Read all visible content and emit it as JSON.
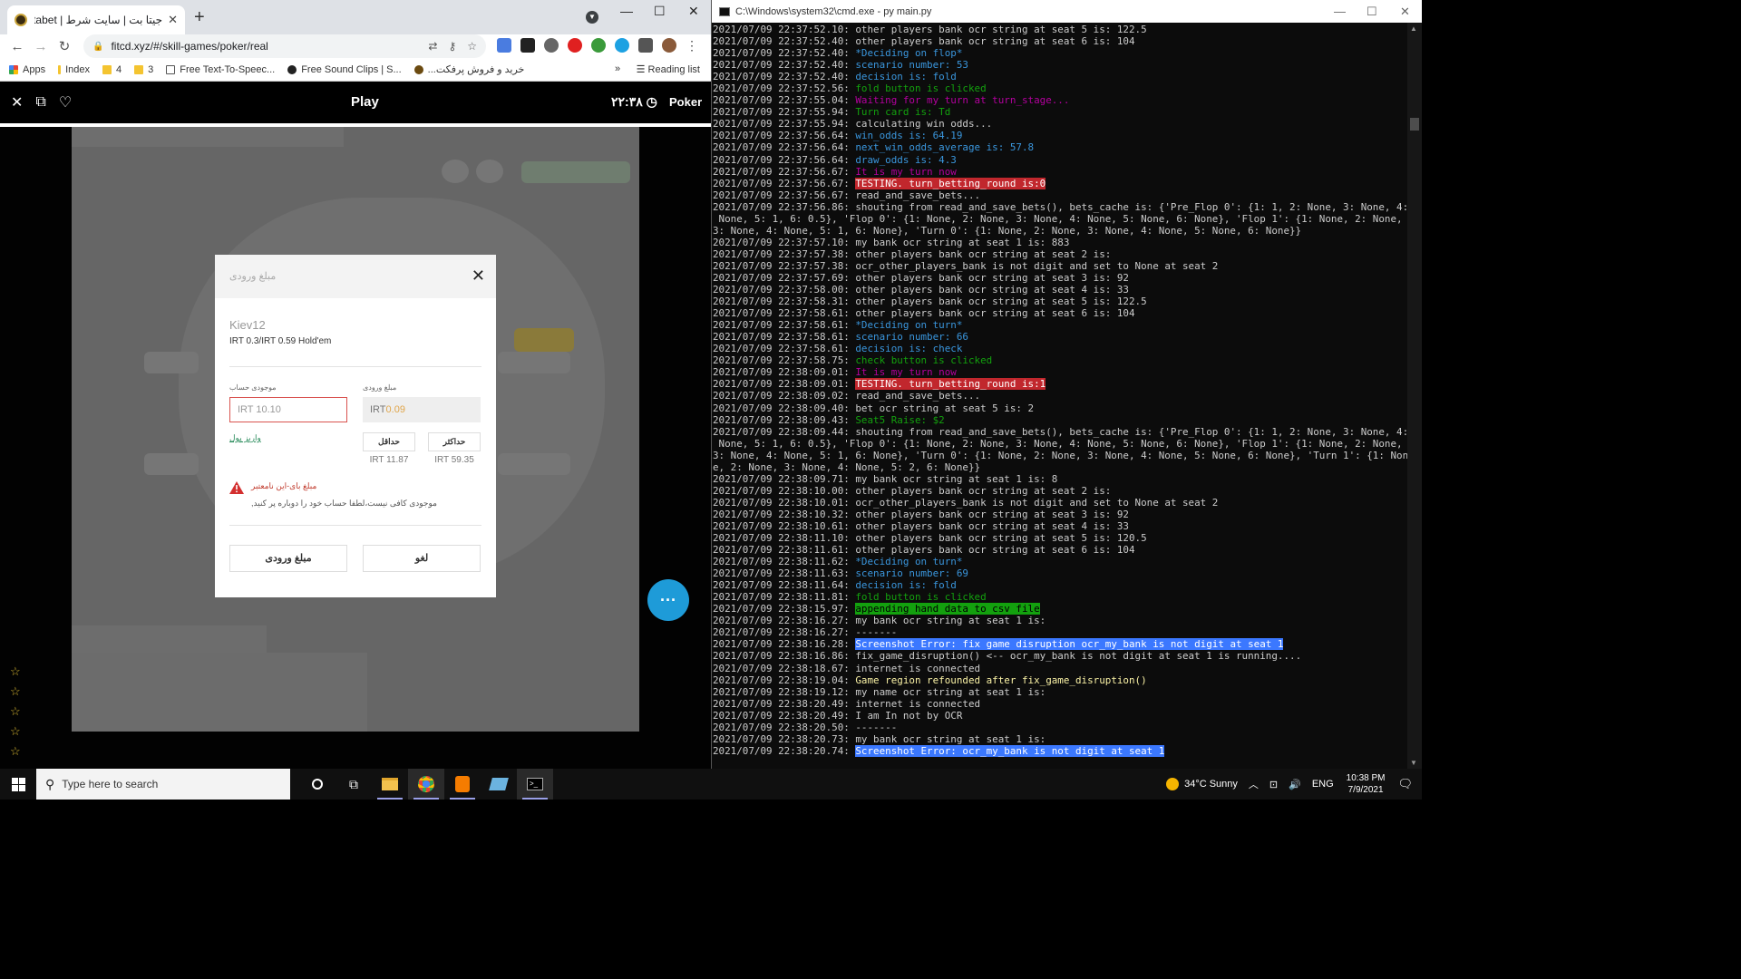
{
  "browser": {
    "tab_title": "جیتا بت | سایت شرط | cheetabet",
    "url": "fitcd.xyz/#/skill-games/poker/real",
    "bookmarks": [
      "Apps",
      "Index",
      "4",
      "3",
      "Free Text-To-Speec...",
      "Free Sound Clips | S...",
      "...خرید و فروش پرفکت"
    ],
    "reading_list": "Reading list"
  },
  "page": {
    "title": "Play",
    "clock": "۲۲:۳۸",
    "brand": "Poker"
  },
  "modal": {
    "title": "مبلغ ورودی",
    "room": "Kiev12",
    "stakes": "IRT 0.3/IRT 0.59 Hold'em",
    "balance_label": "موجودی حساب",
    "entry_label": "مبلغ ورودی",
    "balance_value": "IRT 10.10",
    "entry_prefix": "IRT",
    "entry_value": "0.09",
    "deposit_link": "واریز پول",
    "min_label": "حداقل",
    "max_label": "حداکثر",
    "min_value": "IRT 11.87",
    "max_value": "IRT 59.35",
    "warning_title": "مبلغ بای-این نامعتبر",
    "warning_text": ",موجودی کافی نیست،لطفا حساب خود را دوباره پر کنید",
    "confirm_label": "مبلغ ورودی",
    "cancel_label": "لغو"
  },
  "console": {
    "title": "C:\\Windows\\system32\\cmd.exe - py  main.py",
    "lines": [
      {
        "ts": "2021/07/09 22:37:52.10:",
        "msg": "other players bank ocr string at seat 5 is: 122.5",
        "style": "normal"
      },
      {
        "ts": "2021/07/09 22:37:52.40:",
        "msg": "other players bank ocr string at seat 6 is: 104",
        "style": "normal"
      },
      {
        "ts": "2021/07/09 22:37:52.40:",
        "msg": "*Deciding on flop*",
        "style": "cyan"
      },
      {
        "ts": "2021/07/09 22:37:52.40:",
        "msg": "scenario number: 53",
        "style": "cyan"
      },
      {
        "ts": "2021/07/09 22:37:52.40:",
        "msg": "decision is: fold",
        "style": "cyan"
      },
      {
        "ts": "2021/07/09 22:37:52.56:",
        "msg": "fold button is clicked",
        "style": "green"
      },
      {
        "ts": "2021/07/09 22:37:55.04:",
        "msg": "Waiting for my turn at turn_stage...",
        "style": "magenta"
      },
      {
        "ts": "2021/07/09 22:37:55.94:",
        "msg": "Turn card is: Td",
        "style": "green"
      },
      {
        "ts": "2021/07/09 22:37:55.94:",
        "msg": "calculating win odds...",
        "style": "normal"
      },
      {
        "ts": "2021/07/09 22:37:56.64:",
        "msg": "win_odds is: 64.19",
        "style": "cyan"
      },
      {
        "ts": "2021/07/09 22:37:56.64:",
        "msg": "next_win_odds_average is: 57.8",
        "style": "cyan"
      },
      {
        "ts": "2021/07/09 22:37:56.64:",
        "msg": "draw_odds is: 4.3",
        "style": "cyan"
      },
      {
        "ts": "2021/07/09 22:37:56.67:",
        "msg": "It is my turn now",
        "style": "magenta"
      },
      {
        "ts": "2021/07/09 22:37:56.67:",
        "msg": "TESTING. turn_betting_round is:0",
        "style": "red"
      },
      {
        "ts": "2021/07/09 22:37:56.67:",
        "msg": "read_and_save_bets...",
        "style": "normal"
      },
      {
        "ts": "2021/07/09 22:37:56.86:",
        "msg": "shouting from read_and_save_bets(), bets_cache is: {'Pre_Flop 0': {1: 1, 2: None, 3: None, 4:",
        "style": "normal"
      },
      {
        "ts": "",
        "msg": " None, 5: 1, 6: 0.5}, 'Flop 0': {1: None, 2: None, 3: None, 4: None, 5: None, 6: None}, 'Flop 1': {1: None, 2: None,",
        "style": "normal"
      },
      {
        "ts": "",
        "msg": "3: None, 4: None, 5: 1, 6: None}, 'Turn 0': {1: None, 2: None, 3: None, 4: None, 5: None, 6: None}}",
        "style": "normal"
      },
      {
        "ts": "2021/07/09 22:37:57.10:",
        "msg": "my bank ocr string at seat 1 is: 883",
        "style": "normal"
      },
      {
        "ts": "2021/07/09 22:37:57.38:",
        "msg": "other players bank ocr string at seat 2 is:",
        "style": "normal"
      },
      {
        "ts": "2021/07/09 22:37:57.38:",
        "msg": "ocr_other_players_bank is not digit and set to None at seat 2",
        "style": "normal"
      },
      {
        "ts": "2021/07/09 22:37:57.69:",
        "msg": "other players bank ocr string at seat 3 is: 92",
        "style": "normal"
      },
      {
        "ts": "2021/07/09 22:37:58.00:",
        "msg": "other players bank ocr string at seat 4 is: 33",
        "style": "normal"
      },
      {
        "ts": "2021/07/09 22:37:58.31:",
        "msg": "other players bank ocr string at seat 5 is: 122.5",
        "style": "normal"
      },
      {
        "ts": "2021/07/09 22:37:58.61:",
        "msg": "other players bank ocr string at seat 6 is: 104",
        "style": "normal"
      },
      {
        "ts": "2021/07/09 22:37:58.61:",
        "msg": "*Deciding on turn*",
        "style": "cyan"
      },
      {
        "ts": "2021/07/09 22:37:58.61:",
        "msg": "scenario number: 66",
        "style": "cyan"
      },
      {
        "ts": "2021/07/09 22:37:58.61:",
        "msg": "decision is: check",
        "style": "cyan"
      },
      {
        "ts": "2021/07/09 22:37:58.75:",
        "msg": "check button is clicked",
        "style": "green"
      },
      {
        "ts": "2021/07/09 22:38:09.01:",
        "msg": "It is my turn now",
        "style": "magenta"
      },
      {
        "ts": "2021/07/09 22:38:09.01:",
        "msg": "TESTING. turn_betting_round is:1",
        "style": "red"
      },
      {
        "ts": "2021/07/09 22:38:09.02:",
        "msg": "read_and_save_bets...",
        "style": "normal"
      },
      {
        "ts": "2021/07/09 22:38:09.40:",
        "msg": "bet ocr string at seat 5 is: 2",
        "style": "normal"
      },
      {
        "ts": "2021/07/09 22:38:09.43:",
        "msg": "Seat5 Raise: $2",
        "style": "green"
      },
      {
        "ts": "2021/07/09 22:38:09.44:",
        "msg": "shouting from read_and_save_bets(), bets_cache is: {'Pre_Flop 0': {1: 1, 2: None, 3: None, 4:",
        "style": "normal"
      },
      {
        "ts": "",
        "msg": " None, 5: 1, 6: 0.5}, 'Flop 0': {1: None, 2: None, 3: None, 4: None, 5: None, 6: None}, 'Flop 1': {1: None, 2: None,",
        "style": "normal"
      },
      {
        "ts": "",
        "msg": "3: None, 4: None, 5: 1, 6: None}, 'Turn 0': {1: None, 2: None, 3: None, 4: None, 5: None, 6: None}, 'Turn 1': {1: Non",
        "style": "normal"
      },
      {
        "ts": "",
        "msg": "e, 2: None, 3: None, 4: None, 5: 2, 6: None}}",
        "style": "normal"
      },
      {
        "ts": "2021/07/09 22:38:09.71:",
        "msg": "my bank ocr string at seat 1 is: 8",
        "style": "normal"
      },
      {
        "ts": "2021/07/09 22:38:10.00:",
        "msg": "other players bank ocr string at seat 2 is:",
        "style": "normal"
      },
      {
        "ts": "2021/07/09 22:38:10.01:",
        "msg": "ocr_other_players_bank is not digit and set to None at seat 2",
        "style": "normal"
      },
      {
        "ts": "2021/07/09 22:38:10.32:",
        "msg": "other players bank ocr string at seat 3 is: 92",
        "style": "normal"
      },
      {
        "ts": "2021/07/09 22:38:10.61:",
        "msg": "other players bank ocr string at seat 4 is: 33",
        "style": "normal"
      },
      {
        "ts": "2021/07/09 22:38:11.10:",
        "msg": "other players bank ocr string at seat 5 is: 120.5",
        "style": "normal"
      },
      {
        "ts": "2021/07/09 22:38:11.61:",
        "msg": "other players bank ocr string at seat 6 is: 104",
        "style": "normal"
      },
      {
        "ts": "2021/07/09 22:38:11.62:",
        "msg": "*Deciding on turn*",
        "style": "cyan"
      },
      {
        "ts": "2021/07/09 22:38:11.63:",
        "msg": "scenario number: 69",
        "style": "cyan"
      },
      {
        "ts": "2021/07/09 22:38:11.64:",
        "msg": "decision is: fold",
        "style": "cyan"
      },
      {
        "ts": "2021/07/09 22:38:11.81:",
        "msg": "fold button is clicked",
        "style": "green"
      },
      {
        "ts": "2021/07/09 22:38:15.97:",
        "msg": "appending hand data to csv file",
        "style": "greenbg"
      },
      {
        "ts": "2021/07/09 22:38:16.27:",
        "msg": "my bank ocr string at seat 1 is:",
        "style": "normal"
      },
      {
        "ts": "2021/07/09 22:38:16.27:",
        "msg": "-------",
        "style": "normal"
      },
      {
        "ts": "2021/07/09 22:38:16.28:",
        "msg": "Screenshot Error: fix game disruption ocr_my_bank is not digit at seat 1",
        "style": "bluebg"
      },
      {
        "ts": "2021/07/09 22:38:16.86:",
        "msg": "fix_game_disruption() <-- ocr_my_bank is not digit at seat 1 is running....",
        "style": "normal"
      },
      {
        "ts": "2021/07/09 22:38:18.67:",
        "msg": "internet is connected",
        "style": "normal"
      },
      {
        "ts": "2021/07/09 22:38:19.04:",
        "msg": "Game region refounded after fix_game_disruption()",
        "style": "yellow"
      },
      {
        "ts": "2021/07/09 22:38:19.12:",
        "msg": "my name ocr string at seat 1 is:",
        "style": "normal"
      },
      {
        "ts": "2021/07/09 22:38:20.49:",
        "msg": "internet is connected",
        "style": "normal"
      },
      {
        "ts": "2021/07/09 22:38:20.49:",
        "msg": "I am In not by OCR",
        "style": "normal"
      },
      {
        "ts": "2021/07/09 22:38:20.50:",
        "msg": "-------",
        "style": "normal"
      },
      {
        "ts": "2021/07/09 22:38:20.73:",
        "msg": "my bank ocr string at seat 1 is:",
        "style": "normal"
      },
      {
        "ts": "2021/07/09 22:38:20.74:",
        "msg": "Screenshot Error: ocr_my_bank is not digit at seat 1",
        "style": "bluebg"
      }
    ]
  },
  "taskbar": {
    "search_placeholder": "Type here to search",
    "weather": "34°C  Sunny",
    "lang": "ENG",
    "time": "10:38 PM",
    "date": "7/9/2021"
  },
  "colors": {
    "cyan": "#3a96dd",
    "green": "#13a10e",
    "magenta": "#b4009e",
    "yellow": "#f9f1a5",
    "normal": "#cccccc"
  }
}
